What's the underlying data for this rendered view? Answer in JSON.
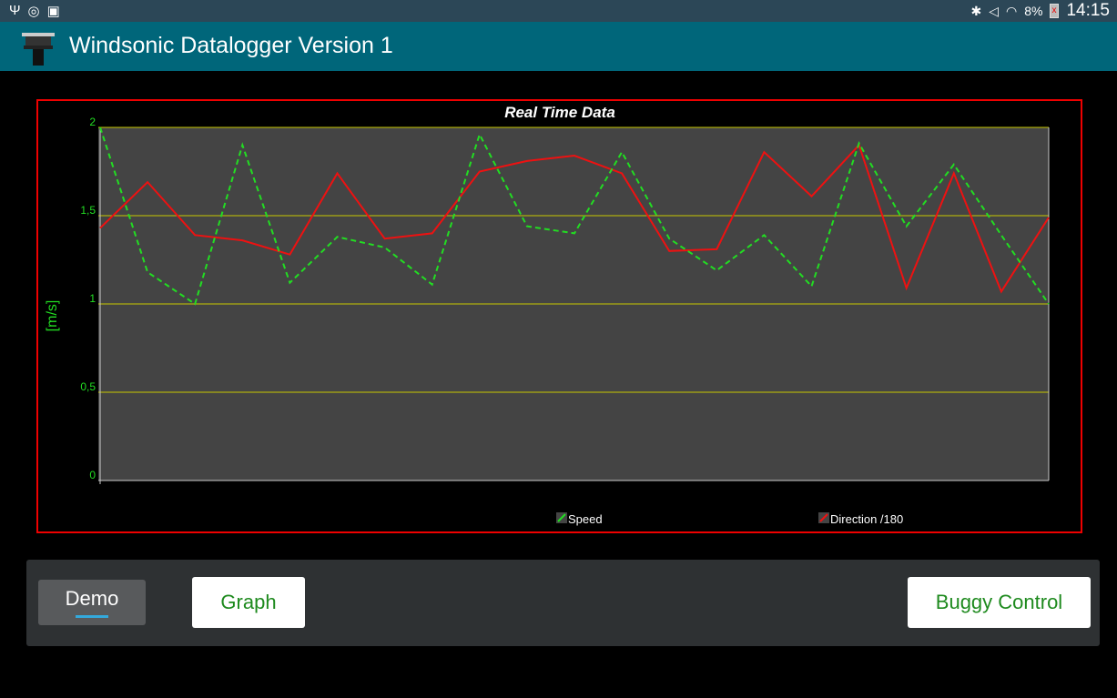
{
  "status_bar": {
    "left_icons": [
      "usb-icon",
      "sync-icon",
      "briefcase-icon"
    ],
    "right_icons": [
      "bluetooth-icon",
      "mute-icon",
      "wifi-icon",
      "battery-icon"
    ],
    "battery": "8%",
    "time": "14:15"
  },
  "app_bar": {
    "title": "Windsonic Datalogger Version 1"
  },
  "chart_data": {
    "type": "line",
    "title": "Real Time Data",
    "xlabel": "",
    "ylabel": "[m/s]",
    "ylim": [
      0,
      2
    ],
    "yticks": [
      "0",
      "0,5",
      "1",
      "1,5",
      "2"
    ],
    "grid": true,
    "legend_placement": "bottom",
    "x": [
      0,
      1,
      2,
      3,
      4,
      5,
      6,
      7,
      8,
      9,
      10,
      11,
      12,
      13,
      14,
      15,
      16,
      17,
      18,
      19,
      20
    ],
    "series": [
      {
        "name": "Speed",
        "color": "#22dd22",
        "dashed": true,
        "values": [
          2.0,
          1.18,
          1.0,
          1.9,
          1.12,
          1.38,
          1.32,
          1.11,
          1.96,
          1.44,
          1.4,
          1.86,
          1.37,
          1.19,
          1.39,
          1.1,
          1.91,
          1.44,
          1.79,
          1.39,
          1.0
        ]
      },
      {
        "name": "Direction /180",
        "color": "#ee1111",
        "dashed": false,
        "values": [
          1.43,
          1.69,
          1.39,
          1.36,
          1.28,
          1.74,
          1.37,
          1.4,
          1.75,
          1.81,
          1.84,
          1.74,
          1.3,
          1.31,
          1.86,
          1.61,
          1.9,
          1.09,
          1.74,
          1.07,
          1.49
        ]
      }
    ]
  },
  "buttons": {
    "demo": "Demo",
    "graph": "Graph",
    "buggy": "Buggy Control"
  }
}
